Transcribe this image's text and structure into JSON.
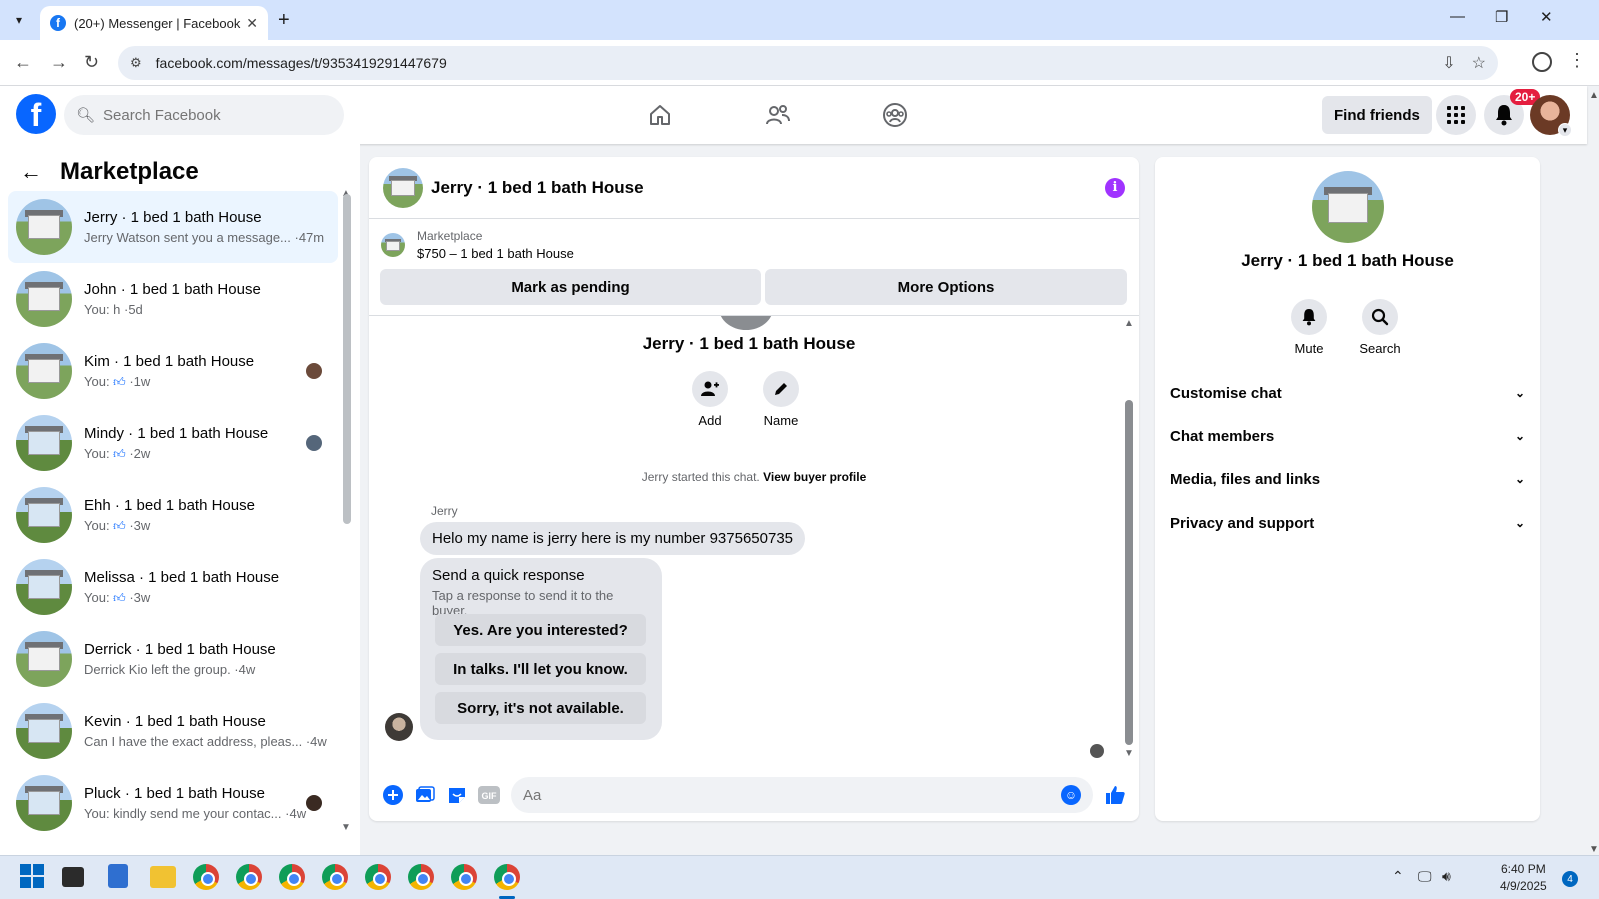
{
  "browser": {
    "tab_title": "(20+) Messenger | Facebook",
    "url": "facebook.com/messages/t/9353419291447679",
    "new_tab_label": "+",
    "close_tab_label": "✕"
  },
  "header": {
    "search_placeholder": "Search Facebook",
    "find_friends": "Find friends",
    "notifications_badge": "20+"
  },
  "sidebar": {
    "title": "Marketplace",
    "chats": [
      {
        "name": "Jerry · 1 bed 1 bath House",
        "preview": "Jerry Watson sent you a message... ·47m",
        "active": true
      },
      {
        "name": "John · 1 bed 1 bath House",
        "preview": "You: h ·5d"
      },
      {
        "name": "Kim · 1 bed 1 bath House",
        "preview_prefix": "You: ",
        "preview_suffix": " ·1w"
      },
      {
        "name": "Mindy · 1 bed 1 bath House",
        "preview_prefix": "You: ",
        "preview_suffix": " ·2w"
      },
      {
        "name": "Ehh · 1 bed 1 bath House",
        "preview_prefix": "You: ",
        "preview_suffix": " ·3w"
      },
      {
        "name": "Melissa · 1 bed 1 bath House",
        "preview_prefix": "You: ",
        "preview_suffix": " ·3w"
      },
      {
        "name": "Derrick · 1 bed 1 bath House",
        "preview": "Derrick Kio left the group. ·4w"
      },
      {
        "name": "Kevin · 1 bed 1 bath House",
        "preview": "Can I have the exact address, pleas... ·4w"
      },
      {
        "name": "Pluck · 1 bed 1 bath House",
        "preview": "You: kindly send me your contac... ·4w"
      }
    ]
  },
  "conversation": {
    "title": "Jerry · 1 bed 1 bath House",
    "listing_label": "Marketplace",
    "listing_price": "$750 – 1 bed 1 bath House",
    "mark_pending": "Mark as pending",
    "more_options": "More Options",
    "thread_title": "Jerry · 1 bed 1 bath House",
    "add_label": "Add",
    "name_label": "Name",
    "started_text": "Jerry started this chat.",
    "view_profile": "View buyer profile",
    "sender": "Jerry",
    "message": "Helo my name is jerry here is my number 9375650735",
    "quick_title": "Send a quick response",
    "quick_sub": "Tap a response to send it to the buyer.",
    "quick_replies": [
      "Yes. Are you interested?",
      "In talks. I'll let you know.",
      "Sorry, it's not available."
    ],
    "composer_placeholder": "Aa"
  },
  "details": {
    "name": "Jerry · 1 bed 1 bath House",
    "mute": "Mute",
    "search": "Search",
    "sections": [
      "Customise chat",
      "Chat members",
      "Media, files and links",
      "Privacy and support"
    ]
  },
  "taskbar": {
    "time": "6:40 PM",
    "date": "4/9/2025",
    "notification_count": "4"
  },
  "colors": {
    "facebook_blue": "#0866ff",
    "active_chat_bg": "#ebf5ff",
    "info_purple": "#a033ff",
    "badge_red": "#e41e3f"
  }
}
